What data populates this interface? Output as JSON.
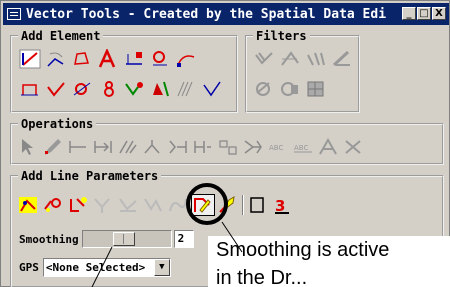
{
  "window": {
    "title": "Vector Tools - Created by the Spatial Data Editor",
    "buttons": {
      "minimize": "_",
      "maximize": "□",
      "close": "X"
    }
  },
  "groups": {
    "add_element": {
      "label": "Add Element",
      "row1_icons": [
        "line-red-icon",
        "line-arc-icon",
        "polygon-icon",
        "text-label-icon",
        "add-node-icon",
        "add-vertex-icon",
        "spline-icon"
      ],
      "row2_icons": [
        "closed-line-icon",
        "curve-icon",
        "polyline-icon",
        "region-icon",
        "edit-node-icon",
        "pen-icon",
        "hatch-icon",
        "check-icon"
      ]
    },
    "filters": {
      "label": "Filters",
      "row1_icons": [
        "filter-lines-icon",
        "filter-angle-icon",
        "filter-points-icon",
        "filter-edit-icon"
      ],
      "row2_icons": [
        "filter-polygon-icon",
        "filter-region-icon",
        "filter-grid-icon"
      ]
    },
    "operations": {
      "label": "Operations",
      "icons": [
        "select-arrow-icon",
        "pencil-icon",
        "split-icon",
        "join-icon",
        "trim-icon",
        "extend-icon",
        "snap-icon",
        "stretch-icon",
        "reshape-icon",
        "merge-icon",
        "curve-fit-icon",
        "label-icon",
        "node-icon",
        "erase-icon"
      ]
    },
    "add_line_parameters": {
      "label": "Add Line Parameters",
      "icons": [
        "stream-icon",
        "rubber-band-icon",
        "auto-close-icon",
        "branch-icon",
        "follow-icon",
        "trace-icon",
        "smooth-icon",
        "smooth-edit-icon",
        "polygon-outline-icon",
        "gps-icon"
      ],
      "active_icon": "smooth-icon",
      "smoothing": {
        "label": "Smoothing",
        "value": "2",
        "level": 0.45
      },
      "gps": {
        "label": "GPS",
        "selected": "<None Selected>"
      }
    }
  },
  "callout": {
    "line1": "Smoothing is active",
    "line2": "in the Dr..."
  },
  "colors": {
    "titlebar": "#0a246a",
    "highlight_circle": "#000000"
  }
}
